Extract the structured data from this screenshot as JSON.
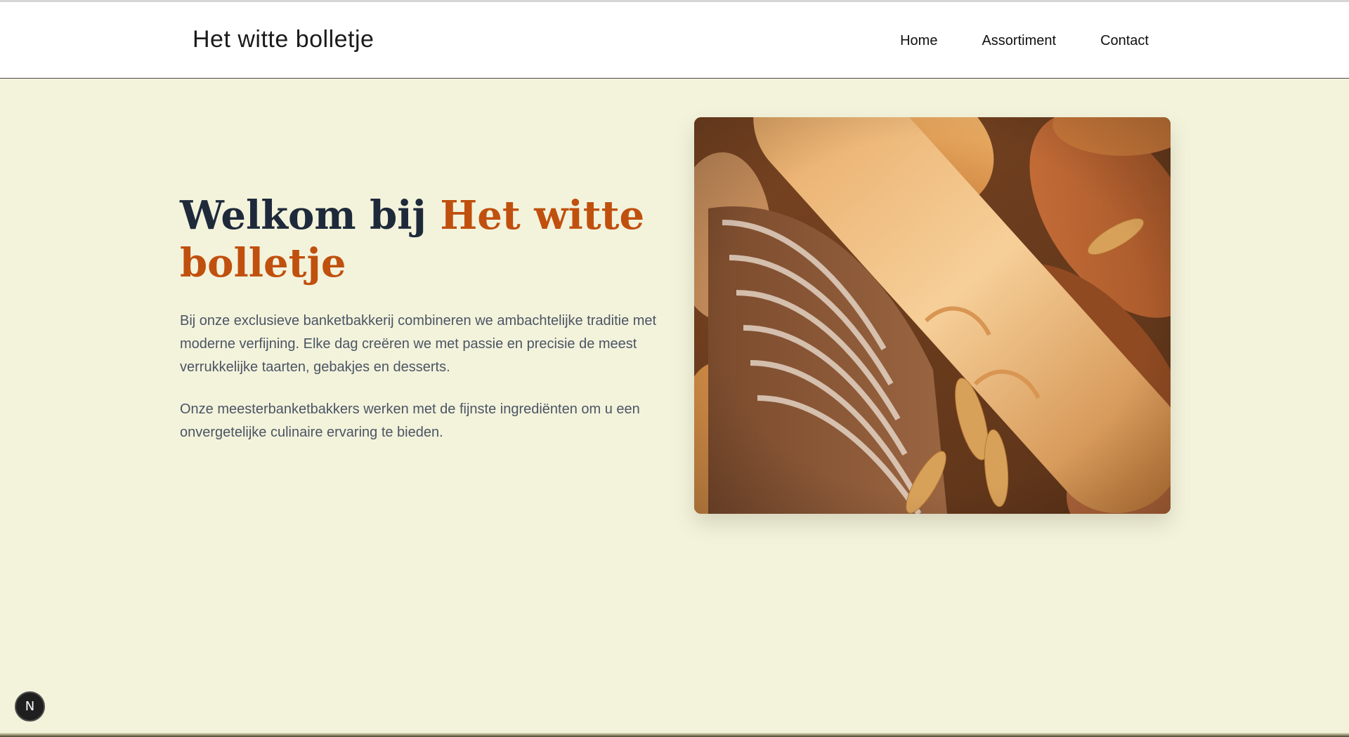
{
  "header": {
    "brand": "Het witte bolletje",
    "nav": [
      {
        "label": "Home"
      },
      {
        "label": "Assortiment"
      },
      {
        "label": "Contact"
      }
    ]
  },
  "hero": {
    "title_part1": "Welkom bij ",
    "title_accent": "Het witte bolletje",
    "paragraph1": "Bij onze exclusieve banketbakkerij combineren we ambachtelijke traditie met moderne verfijning. Elke dag creëren we met passie en precisie de meest verrukkelijke taarten, gebakjes en desserts.",
    "paragraph2": "Onze meesterbanketbakkers werken met de fijnste ingrediënten om u een onvergetelijke culinaire ervaring te bieden.",
    "image": "bread-photo"
  },
  "dev_badge": {
    "letter": "N"
  },
  "colors": {
    "page_background": "#f3f3dc",
    "header_background": "#ffffff",
    "heading": "#1e2a3a",
    "accent": "#c0500e",
    "body_text": "#4b5563"
  }
}
